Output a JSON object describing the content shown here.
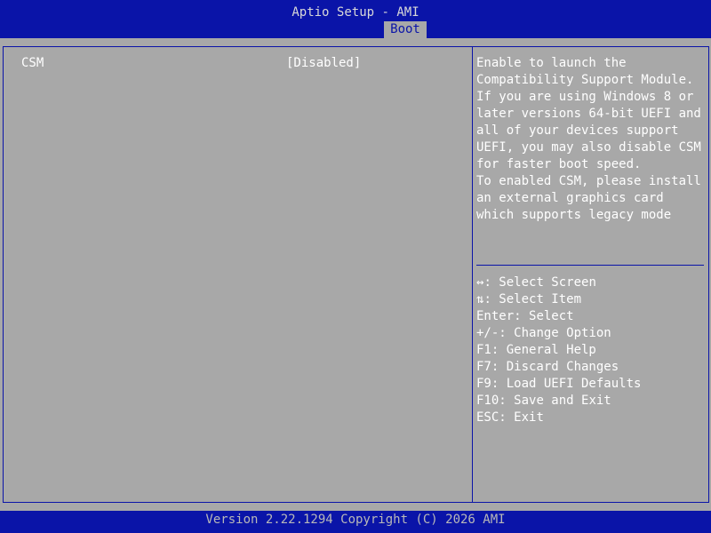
{
  "header": {
    "title": "Aptio Setup - AMI",
    "active_tab": "Boot"
  },
  "settings": [
    {
      "label": "CSM",
      "value": "[Disabled]"
    }
  ],
  "help": {
    "lines": [
      "Enable to launch the",
      "Compatibility Support Module.",
      "If you are using Windows 8 or",
      "later versions 64-bit UEFI and",
      "all of your devices support",
      "UEFI, you may also disable CSM",
      "for faster boot speed.",
      "To enabled CSM, please install",
      "an external graphics card",
      "which supports legacy mode"
    ]
  },
  "keys": [
    {
      "key": "↔",
      "suffix": ": Select Screen",
      "icon": "left-right-arrow-icon"
    },
    {
      "key": "⇅",
      "suffix": ": Select Item",
      "icon": "up-down-arrow-icon"
    },
    {
      "key": "Enter",
      "suffix": ": Select"
    },
    {
      "key": "+/-",
      "suffix": ": Change Option"
    },
    {
      "key": "F1",
      "suffix": ": General Help"
    },
    {
      "key": "F7",
      "suffix": ": Discard Changes"
    },
    {
      "key": "F9",
      "suffix": ": Load UEFI Defaults"
    },
    {
      "key": "F10",
      "suffix": ": Save and Exit"
    },
    {
      "key": "ESC",
      "suffix": ": Exit"
    }
  ],
  "footer": {
    "version": "Version 2.22.1294 Copyright (C) 2026 AMI"
  },
  "colors": {
    "bar_blue": "#0a14a8",
    "panel_gray": "#a8a8a8",
    "text_white": "#ffffff"
  }
}
